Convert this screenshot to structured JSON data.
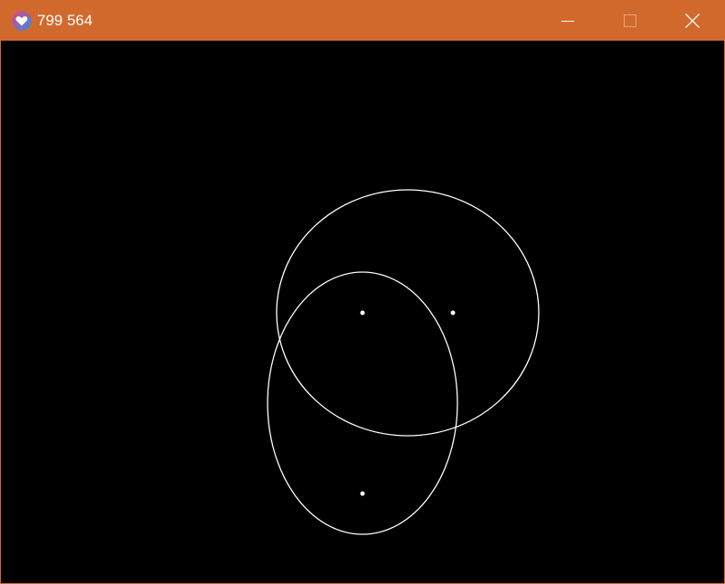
{
  "window": {
    "title": "799 564",
    "app_icon": "heart-app-icon",
    "controls": {
      "minimize_icon": "minimize-icon",
      "maximize_icon": "maximize-icon",
      "close_icon": "close-icon"
    }
  },
  "colors": {
    "titlebar": "#d2692c",
    "canvas_background": "#000000",
    "shape_stroke": "#ffffff",
    "icon_gradient_start": "#e8437a",
    "icon_gradient_end": "#2f8fe0"
  },
  "canvas": {
    "shapes": [
      {
        "type": "ellipse-outline",
        "name": "upper-ellipse"
      },
      {
        "type": "ellipse-outline",
        "name": "lower-ellipse"
      }
    ],
    "points": [
      {
        "name": "upper-ellipse-focus-left"
      },
      {
        "name": "upper-ellipse-focus-right"
      },
      {
        "name": "lower-ellipse-focus-bottom"
      }
    ]
  }
}
